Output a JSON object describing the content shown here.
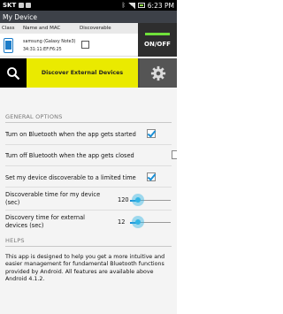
{
  "status_bar": {
    "carrier": "SKT",
    "time": "6:23 PM"
  },
  "app": {
    "title": "My Device"
  },
  "device_table": {
    "headers": [
      "Class",
      "Name and MAC",
      "Discoverable"
    ],
    "row": {
      "name": "samsung (Galaxy Note3)",
      "mac": "34:31:11:EF:F6:25",
      "discoverable": false
    }
  },
  "power_toggle": {
    "label": "ON/OFF",
    "state": true
  },
  "discover": {
    "label": "Discover External Devices"
  },
  "general_options": {
    "header": "GENERAL OPTIONS",
    "items": [
      {
        "label": "Turn on Bluetooth when the app gets started",
        "checked": true
      },
      {
        "label": "Turn off Bluetooth when the app gets closed",
        "checked": false
      },
      {
        "label": "Set my device discoverable to a limited time",
        "checked": true
      }
    ],
    "sliders": [
      {
        "label_line1": "Discoverable time for my device",
        "label_line2": "(sec)",
        "value": "120",
        "fraction": 0.2
      },
      {
        "label_line1": "Discovery time for external",
        "label_line2": "devices (sec)",
        "value": "12",
        "fraction": 0.2
      }
    ]
  },
  "helps": {
    "header": "HELPS",
    "text": "This app is designed to help you get a more intuitive and easier management for fundamental Bluetooth functions provided by Android. All features are available above Android 4.1.2."
  },
  "colors": {
    "accent": "#33b5e5",
    "discover_button": "#eaea00",
    "led": "#6fe03a",
    "title_bar": "#3d4148"
  }
}
